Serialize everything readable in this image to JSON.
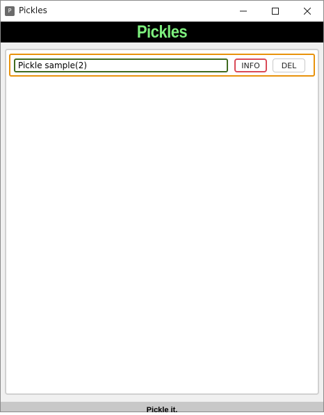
{
  "window": {
    "title": "Pickles",
    "icon_letter": "P",
    "controls": [
      "minimize-icon",
      "maximize-icon",
      "close-icon"
    ]
  },
  "header": {
    "title": "Pickles",
    "title_color": "#7ef07e",
    "background": "#000000"
  },
  "items": [
    {
      "name": "Pickle sample(2)",
      "info_label": "INFO",
      "delete_label": "DEL"
    }
  ],
  "footer": {
    "text": "Pickle it."
  },
  "colors": {
    "row_border": "#e8920b",
    "input_border": "#3f6b1f",
    "info_border": "#d94a57"
  }
}
